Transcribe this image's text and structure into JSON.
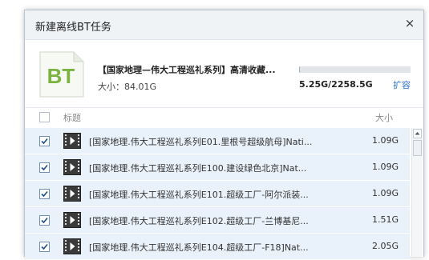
{
  "dialog": {
    "title": "新建离线BT任务",
    "close_label": "×"
  },
  "task": {
    "logo_text": "BT",
    "name": "【国家地理—伟大工程巡礼系列】高清收藏...",
    "size_line": "大小：84.01G"
  },
  "quota": {
    "text": "5.25G/2258.5G",
    "used_fraction": 0.0023,
    "expand_label": "扩容"
  },
  "list": {
    "header_title": "标题",
    "header_size": "大小",
    "files": [
      {
        "name": "[国家地理.伟大工程巡礼系列E01.里根号超级航母]Nati...",
        "size": "1.09G",
        "checked": true
      },
      {
        "name": "[国家地理.伟大工程巡礼系列E100.建设绿色北京]Nat...",
        "size": "1.09G",
        "checked": true
      },
      {
        "name": "[国家地理.伟大工程巡礼系列E101.超级工厂-阿尔派装...",
        "size": "1.09G",
        "checked": true
      },
      {
        "name": "[国家地理.伟大工程巡礼系列E102.超级工厂-兰博基尼...",
        "size": "1.51G",
        "checked": true
      },
      {
        "name": "[国家地理.伟大工程巡礼系列E104.超级工厂-F18]Nat...",
        "size": "2.05G",
        "checked": true
      }
    ]
  },
  "colors": {
    "logo_green": "#7ab33f",
    "link_blue": "#2a6fc9",
    "row_background": "#e9f1fa"
  }
}
